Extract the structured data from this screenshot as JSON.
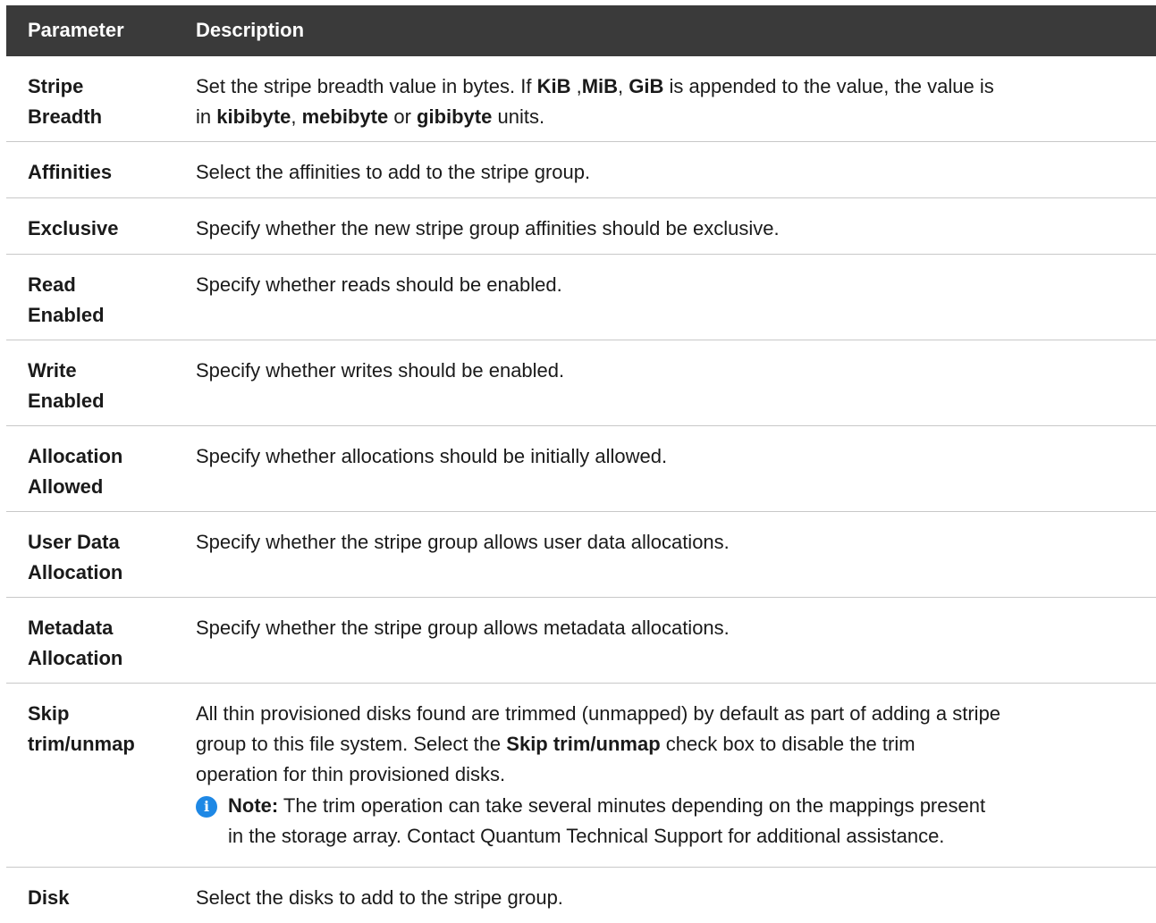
{
  "header": {
    "param": "Parameter",
    "description": "Description"
  },
  "rows": [
    {
      "param_l1": "Stripe",
      "param_l2": "Breadth",
      "d_a": "Set the stripe breadth value in bytes. If ",
      "d_kib": "KiB",
      "d_b": " ,",
      "d_mib": "MiB",
      "d_c": ", ",
      "d_gib": "GiB",
      "d_d": " is appended to the value, the value is",
      "d_e": "in ",
      "d_kibibyte": "kibibyte",
      "d_f": ", ",
      "d_mebibyte": "mebibyte",
      "d_g": " or ",
      "d_gibibyte": "gibibyte",
      "d_h": " units."
    },
    {
      "param_l1": "Affinities",
      "desc": "Select the affinities to add to the stripe group."
    },
    {
      "param_l1": "Exclusive",
      "desc": "Specify whether the new stripe group affinities should be exclusive."
    },
    {
      "param_l1": "Read",
      "param_l2": "Enabled",
      "desc": "Specify whether reads should be enabled."
    },
    {
      "param_l1": "Write",
      "param_l2": "Enabled",
      "desc": "Specify whether writes should be enabled."
    },
    {
      "param_l1": "Allocation",
      "param_l2": "Allowed",
      "desc": "Specify whether allocations should be initially allowed."
    },
    {
      "param_l1": "User Data",
      "param_l2": "Allocation",
      "desc": "Specify whether the stripe group allows user data allocations."
    },
    {
      "param_l1": "Metadata",
      "param_l2": "Allocation",
      "desc": "Specify whether the stripe group allows metadata allocations."
    },
    {
      "param_l1": "Skip",
      "param_l2": "trim/unmap",
      "d_a": "All thin provisioned disks found are trimmed (unmapped) by default as part of adding a stripe",
      "d_b": "group to this file system. Select the ",
      "d_bold": "Skip trim/unmap",
      "d_c": " check box to disable the trim",
      "d_d": "operation for thin provisioned disks.",
      "note_label": "Note:",
      "note_l1": " The trim operation can take several minutes depending on the mappings present",
      "note_l2": "in the storage array. Contact Quantum Technical Support for additional assistance.",
      "note_icon": "info-icon"
    },
    {
      "param_l1": "Disk",
      "desc": "Select the disks to add to the stripe group."
    }
  ]
}
